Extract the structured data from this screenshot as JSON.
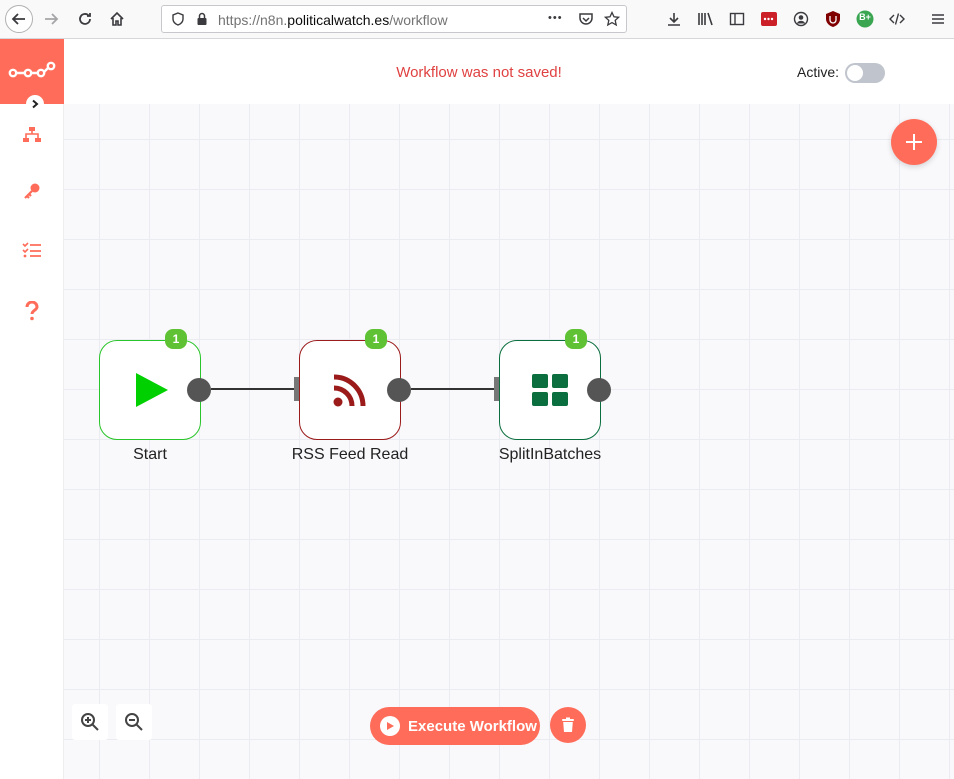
{
  "browser": {
    "url_prefix": "https://n8n.",
    "url_host": "politicalwatch.es",
    "url_path": "/workflow",
    "menu_dots": "•••",
    "addon_badge": "B+"
  },
  "header": {
    "save_status": "Workflow was not saved!",
    "active_label": "Active:",
    "active": false
  },
  "nodes": [
    {
      "name": "Start",
      "badge": "1",
      "color": "#2ac52a"
    },
    {
      "name": "RSS Feed Read",
      "badge": "1",
      "color": "#9b1a1a"
    },
    {
      "name": "SplitInBatches",
      "badge": "1",
      "color": "#0a6e3e"
    }
  ],
  "actions": {
    "execute_label": "Execute Workflow"
  },
  "colors": {
    "accent": "#ff6d5a",
    "badge": "#5fc234",
    "error_text": "#e04141"
  }
}
